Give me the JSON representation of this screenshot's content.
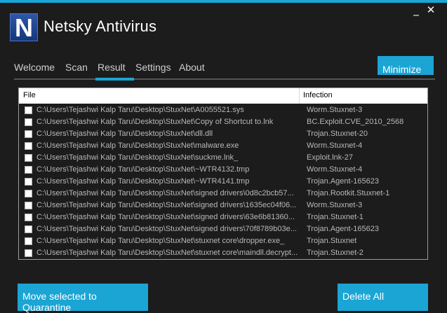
{
  "window": {
    "minimize_glyph": "_",
    "close_glyph": "✕"
  },
  "app": {
    "logo_letter": "N",
    "title": "Netsky Antivirus"
  },
  "tabs": [
    {
      "label": "Welcome"
    },
    {
      "label": "Scan"
    },
    {
      "label": "Result",
      "active": true
    },
    {
      "label": "Settings"
    },
    {
      "label": "About"
    }
  ],
  "buttons": {
    "minimize": "Minimize",
    "quarantine": "Move selected to Quarantine",
    "delete_all": "Delete All"
  },
  "table": {
    "headers": {
      "file": "File",
      "infection": "Infection"
    },
    "rows": [
      {
        "file": "C:\\Users\\Tejashwi Kalp Taru\\Desktop\\StuxNet\\A0055521.sys",
        "infection": "Worm.Stuxnet-3"
      },
      {
        "file": "C:\\Users\\Tejashwi Kalp Taru\\Desktop\\StuxNet\\Copy of Shortcut to.lnk",
        "infection": "BC.Exploit.CVE_2010_2568"
      },
      {
        "file": "C:\\Users\\Tejashwi Kalp Taru\\Desktop\\StuxNet\\dll.dll",
        "infection": "Trojan.Stuxnet-20"
      },
      {
        "file": "C:\\Users\\Tejashwi Kalp Taru\\Desktop\\StuxNet\\malware.exe",
        "infection": "Worm.Stuxnet-4"
      },
      {
        "file": "C:\\Users\\Tejashwi Kalp Taru\\Desktop\\StuxNet\\suckme.lnk_",
        "infection": "Exploit.lnk-27"
      },
      {
        "file": "C:\\Users\\Tejashwi Kalp Taru\\Desktop\\StuxNet\\~WTR4132.tmp",
        "infection": "Worm.Stuxnet-4"
      },
      {
        "file": "C:\\Users\\Tejashwi Kalp Taru\\Desktop\\StuxNet\\~WTR4141.tmp",
        "infection": "Trojan.Agent-165623"
      },
      {
        "file": "C:\\Users\\Tejashwi Kalp Taru\\Desktop\\StuxNet\\signed drivers\\0d8c2bcb57...",
        "infection": "Trojan.Rootkit.Stuxnet-1"
      },
      {
        "file": "C:\\Users\\Tejashwi Kalp Taru\\Desktop\\StuxNet\\signed drivers\\1635ec04f06...",
        "infection": "Worm.Stuxnet-3"
      },
      {
        "file": "C:\\Users\\Tejashwi Kalp Taru\\Desktop\\StuxNet\\signed drivers\\63e6b81360...",
        "infection": "Trojan.Stuxnet-1"
      },
      {
        "file": "C:\\Users\\Tejashwi Kalp Taru\\Desktop\\StuxNet\\signed drivers\\70f8789b03e...",
        "infection": "Trojan.Agent-165623"
      },
      {
        "file": "C:\\Users\\Tejashwi Kalp Taru\\Desktop\\StuxNet\\stuxnet core\\dropper.exe_",
        "infection": "Trojan.Stuxnet"
      },
      {
        "file": "C:\\Users\\Tejashwi Kalp Taru\\Desktop\\StuxNet\\stuxnet core\\maindll.decrypt...",
        "infection": "Trojan.Stuxnet-2"
      }
    ]
  },
  "colors": {
    "accent": "#1aa5d4",
    "background": "#1c1c1c",
    "row_text": "#b8b8b8"
  }
}
